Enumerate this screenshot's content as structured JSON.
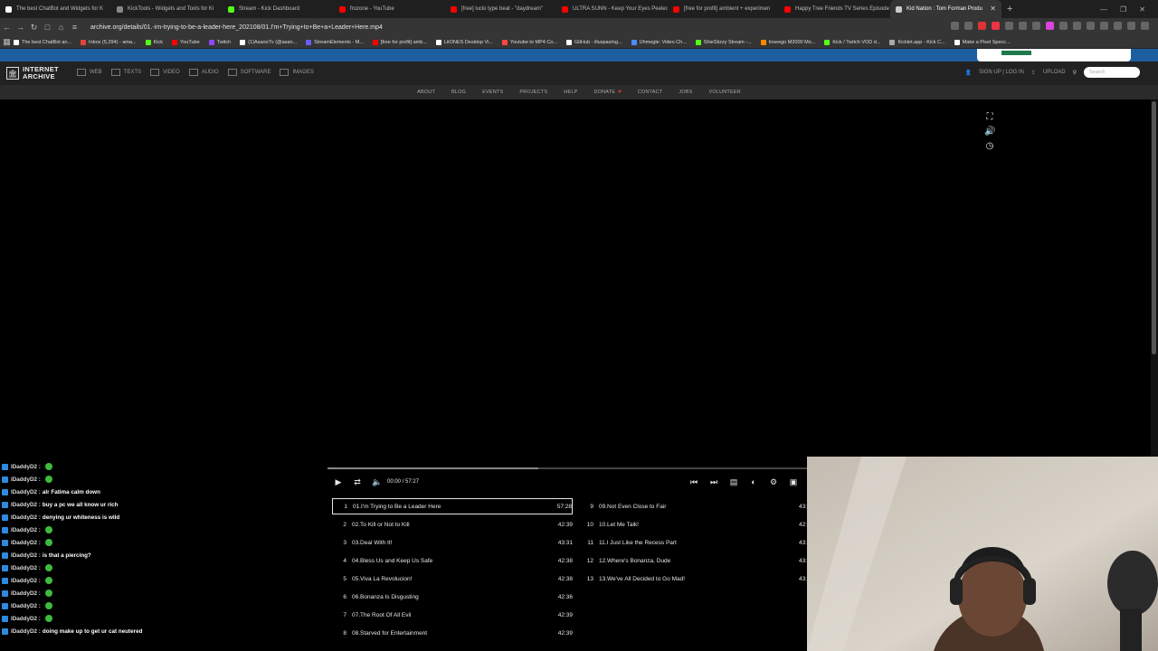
{
  "browser": {
    "tabs": [
      {
        "label": "The best ChatBot and Widgets for K",
        "color": "#ffffff"
      },
      {
        "label": "KickTools - Widgets and Tools for Ki",
        "color": "#888888"
      },
      {
        "label": "Stream - Kick Dashboard",
        "color": "#53fc18"
      },
      {
        "label": "frozone - YouTube",
        "color": "#ff0000"
      },
      {
        "label": "[free] lucki type beat - \"daydream\"",
        "color": "#ff0000"
      },
      {
        "label": "ULTRA SUNN - Keep Your Eyes Peeled",
        "color": "#ff0000"
      },
      {
        "label": "[free for profit] ambient + experimen",
        "color": "#ff0000"
      },
      {
        "label": "Happy Tree Friends TV Series Episode",
        "color": "#ff0000"
      },
      {
        "label": "Kid Nation : Tom Forman Produ",
        "color": "#cccccc",
        "active": true
      }
    ],
    "new_tab": "+",
    "url": "archive.org/details/01.-im-trying-to-be-a-leader-here_202108/01.I'm+Trying+to+Be+a+Leader+Here.mp4",
    "bookmarks": [
      {
        "label": "The best ChatBot an...",
        "color": "#ffffff"
      },
      {
        "label": "Inbox (5,294) - ama...",
        "color": "#e0453a"
      },
      {
        "label": "Kick",
        "color": "#53fc18"
      },
      {
        "label": "YouTube",
        "color": "#ff0000"
      },
      {
        "label": "Twitch",
        "color": "#9146ff"
      },
      {
        "label": "(1)AsanoTv (@asan...",
        "color": "#ffffff"
      },
      {
        "label": "StreamElements - M...",
        "color": "#6b5cff"
      },
      {
        "label": "[free for profit] amb...",
        "color": "#ff0000"
      },
      {
        "label": "LitONES Desktop Vi...",
        "color": "#ffffff"
      },
      {
        "label": "Youtube to MP4 Co...",
        "color": "#ff4444"
      },
      {
        "label": "GitHub - illuspas/ng...",
        "color": "#ffffff"
      },
      {
        "label": "Uhmegle: Video Ch...",
        "color": "#4a8cff"
      },
      {
        "label": "ShieStizzy Stream -...",
        "color": "#53fc18"
      },
      {
        "label": "Inseego M2000 Mo...",
        "color": "#ff8800"
      },
      {
        "label": "Kick / Twitch VOD d...",
        "color": "#53fc18"
      },
      {
        "label": "Kicklet.app - Kick C...",
        "color": "#aaaaaa"
      },
      {
        "label": "Make a Pixel Specc...",
        "color": "#ffffff"
      }
    ]
  },
  "archive": {
    "logo_line1": "INTERNET",
    "logo_line2": "ARCHIVE",
    "media_nav": [
      "WEB",
      "TEXTS",
      "VIDEO",
      "AUDIO",
      "SOFTWARE",
      "IMAGES"
    ],
    "signup": "SIGN UP | LOG IN",
    "upload": "UPLOAD",
    "search_placeholder": "Search",
    "sub_nav": [
      "ABOUT",
      "BLOG",
      "EVENTS",
      "PROJECTS",
      "HELP",
      "DONATE",
      "CONTACT",
      "JOBS",
      "VOLUNTEER"
    ]
  },
  "player": {
    "current_time": "00:00",
    "separator": "/",
    "duration": "57:27",
    "progress_fraction": 0.44,
    "playlist_left": [
      {
        "num": "1",
        "title": "01.I'm Trying to Be a Leader Here",
        "dur": "57:28",
        "active": true
      },
      {
        "num": "2",
        "title": "02.To Kill or Not to Kill",
        "dur": "42:39"
      },
      {
        "num": "3",
        "title": "03.Deal With It!",
        "dur": "43:31"
      },
      {
        "num": "4",
        "title": "04.Bless Us and Keep Us Safe",
        "dur": "42:38"
      },
      {
        "num": "5",
        "title": "05.Viva La Revolucion!",
        "dur": "42:38"
      },
      {
        "num": "6",
        "title": "06.Bonanza Is Disgusting",
        "dur": "42:36"
      },
      {
        "num": "7",
        "title": "07.The Root Of All Evil",
        "dur": "42:39"
      },
      {
        "num": "8",
        "title": "08.Starved for Entertainment",
        "dur": "42:39"
      }
    ],
    "playlist_right": [
      {
        "num": "9",
        "title": "09.Not Even Close to Fair",
        "dur": "43:"
      },
      {
        "num": "10",
        "title": "10.Let Me Talk!",
        "dur": "42:"
      },
      {
        "num": "11",
        "title": "11.I Just Like the Recess Part",
        "dur": "43:"
      },
      {
        "num": "12",
        "title": "12.Where's Bonanza, Dude",
        "dur": "43:"
      },
      {
        "num": "13",
        "title": "13.We've All Decided to Go Mad!",
        "dur": "43:"
      }
    ]
  },
  "chat": {
    "messages": [
      {
        "user": "lDaddyD2 :",
        "msg": "",
        "emote": true
      },
      {
        "user": "lDaddyD2 :",
        "msg": "",
        "emote": true
      },
      {
        "user": "lDaddyD2 :",
        "msg": "alr Fatima calm down",
        "emote": false
      },
      {
        "user": "lDaddyD2 :",
        "msg": "buy a pc we all know ur rich",
        "emote": false
      },
      {
        "user": "lDaddyD2 :",
        "msg": "denying ur whiteness is wild",
        "emote": false
      },
      {
        "user": "lDaddyD2 :",
        "msg": "",
        "emote": true
      },
      {
        "user": "lDaddyD2 :",
        "msg": "",
        "emote": true
      },
      {
        "user": "lDaddyD2 :",
        "msg": "is that a piercing?",
        "emote": false
      },
      {
        "user": "lDaddyD2 :",
        "msg": "",
        "emote": true
      },
      {
        "user": "lDaddyD2 :",
        "msg": "",
        "emote": true
      },
      {
        "user": "lDaddyD2 :",
        "msg": "",
        "emote": true
      },
      {
        "user": "lDaddyD2 :",
        "msg": "",
        "emote": true
      },
      {
        "user": "lDaddyD2 :",
        "msg": "",
        "emote": true
      },
      {
        "user": "lDaddyD2 :",
        "msg": "doing make up to get ur cat neutered",
        "emote": false
      }
    ]
  }
}
